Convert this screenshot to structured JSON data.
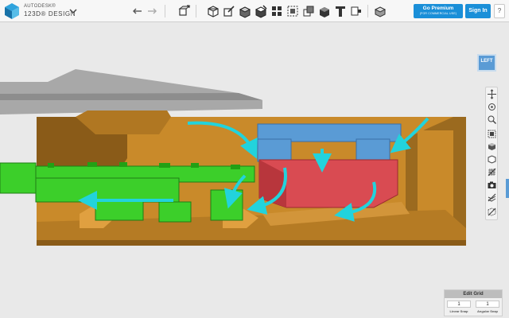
{
  "app": {
    "brand": "AUTODESK®",
    "product": "123D® DESIGN"
  },
  "toolbar": {
    "tools": [
      {
        "name": "undo-icon"
      },
      {
        "name": "redo-icon"
      },
      {
        "name": "transform-icon"
      },
      {
        "name": "primitives-icon"
      },
      {
        "name": "sketch-icon"
      },
      {
        "name": "construct-icon"
      },
      {
        "name": "modify-icon"
      },
      {
        "name": "pattern-icon"
      },
      {
        "name": "grouping-icon"
      },
      {
        "name": "combine-icon"
      },
      {
        "name": "measure-icon"
      },
      {
        "name": "text-icon"
      },
      {
        "name": "snap-icon"
      },
      {
        "name": "material-icon"
      }
    ],
    "premium_label": "Go Premium",
    "premium_sub": "(FOR COMMERCIAL USE)",
    "signin_label": "Sign In",
    "help_label": "?"
  },
  "viewcube": {
    "label": "LEFT"
  },
  "navbar": {
    "items": [
      {
        "name": "pan-icon"
      },
      {
        "name": "orbit-icon"
      },
      {
        "name": "zoom-icon"
      },
      {
        "name": "fit-icon"
      },
      {
        "name": "materials-visibility-icon"
      },
      {
        "name": "outline-icon"
      },
      {
        "name": "grid-toggle-icon"
      },
      {
        "name": "screenshot-icon"
      },
      {
        "name": "isometric-icon"
      },
      {
        "name": "view-solid-icon"
      }
    ]
  },
  "grid": {
    "title": "Edit Grid",
    "linear_value": "1",
    "angular_value": "1",
    "linear_label": "Linear Snap",
    "angular_label": "Angular Snap"
  },
  "colors": {
    "housing": "#c98a2a",
    "housing_dark": "#8a5b18",
    "blue_block": "#5a9bd5",
    "red_part": "#d94b52",
    "green_pcb": "#3ccf2a",
    "arrow": "#22d3dc",
    "accent": "#1a8fd8"
  }
}
